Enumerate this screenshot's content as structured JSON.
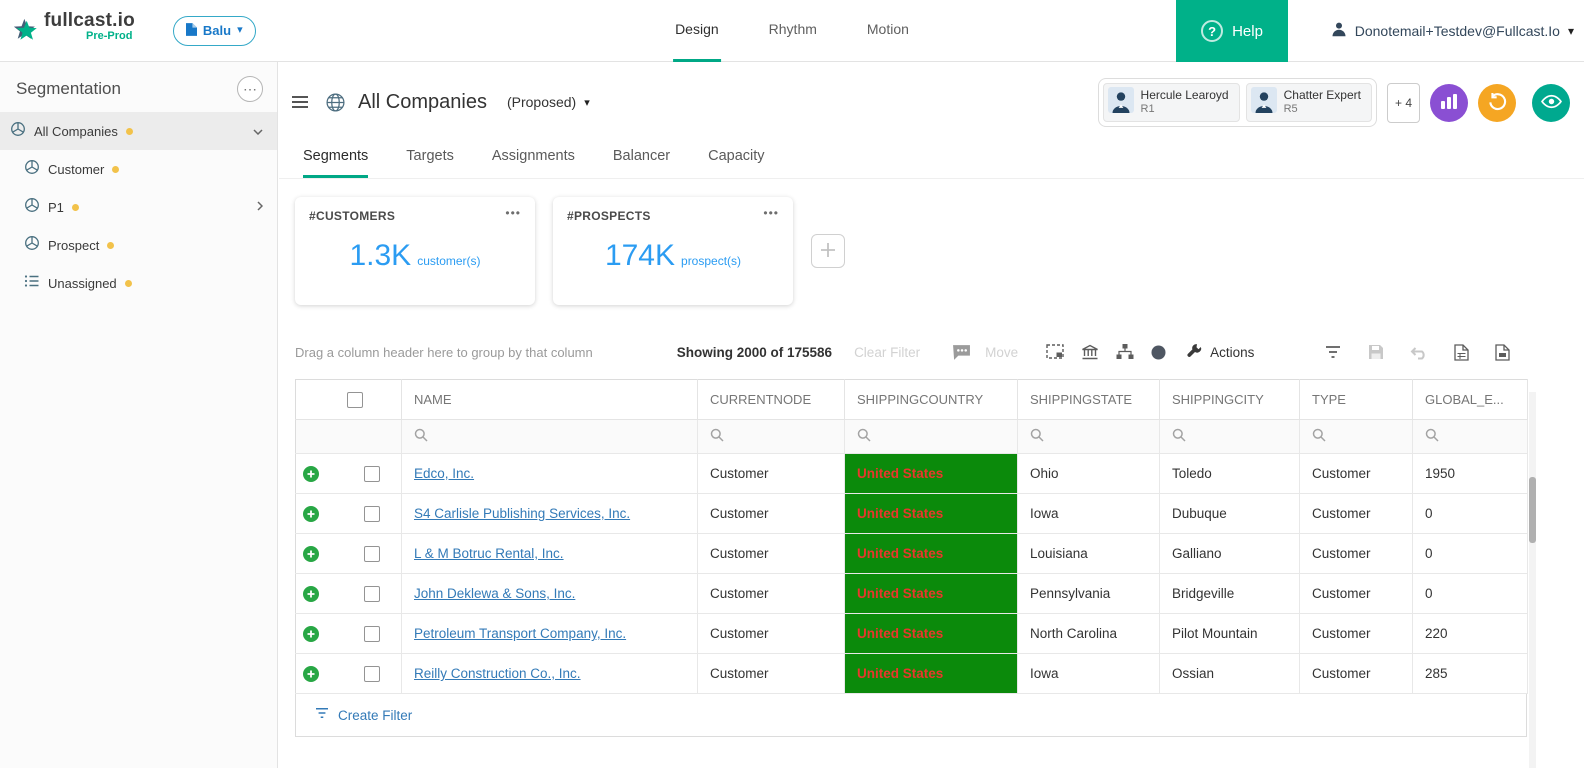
{
  "colors": {
    "brand_teal": "#00B189",
    "tab_accent": "#00A886",
    "link_blue": "#337AB7",
    "metric_blue": "#2B9CF2",
    "country_cell_bg": "#0B8A0B",
    "country_cell_text": "#E8372C",
    "node_dot_yellow": "#F2C24A",
    "purple_button": "#8A4FD3",
    "orange_button": "#F5A623",
    "teal_button": "#00A98F",
    "plus_green": "#28A745"
  },
  "icons": {
    "help_question": "?",
    "sidebar_menu": "⋯",
    "card_menu": "•••",
    "caret_down": "▾"
  },
  "header": {
    "logo_text": "fullcast.io",
    "env_label": "Pre-Prod",
    "workspace_label": "Balu",
    "nav": [
      {
        "label": "Design",
        "active": true
      },
      {
        "label": "Rhythm",
        "active": false
      },
      {
        "label": "Motion",
        "active": false
      }
    ],
    "help_label": "Help",
    "user_email": "Donotemail+Testdev@Fullcast.Io"
  },
  "sidebar": {
    "title": "Segmentation",
    "items": [
      {
        "label": "All Companies",
        "selected": true
      },
      {
        "label": "Customer",
        "selected": false
      },
      {
        "label": "P1",
        "selected": false
      },
      {
        "label": "Prospect",
        "selected": false
      },
      {
        "label": "Unassigned",
        "selected": false
      }
    ]
  },
  "view": {
    "title": "All Companies",
    "mode": "(Proposed)",
    "people": [
      {
        "name": "Hercule Learoyd",
        "role": "R1"
      },
      {
        "name": "Chatter Expert",
        "role": "R5"
      }
    ],
    "more_people": "+ 4"
  },
  "tabs": [
    {
      "label": "Segments",
      "active": true
    },
    {
      "label": "Targets",
      "active": false
    },
    {
      "label": "Assignments",
      "active": false
    },
    {
      "label": "Balancer",
      "active": false
    },
    {
      "label": "Capacity",
      "active": false
    }
  ],
  "cards": [
    {
      "label": "#CUSTOMERS",
      "value": "1.3K",
      "unit": "customer(s)"
    },
    {
      "label": "#PROSPECTS",
      "value": "174K",
      "unit": "prospect(s)"
    }
  ],
  "toolbar": {
    "drag_hint": "Drag a column header here to group by that column",
    "showing": "Showing 2000 of 175586",
    "clear_filter": "Clear Filter",
    "move": "Move",
    "actions": "Actions"
  },
  "grid": {
    "columns": [
      "NAME",
      "CURRENTNODE",
      "SHIPPINGCOUNTRY",
      "SHIPPINGSTATE",
      "SHIPPINGCITY",
      "TYPE",
      "GLOBAL_E..."
    ],
    "rows": [
      {
        "name": "Edco, Inc.",
        "currentnode": "Customer",
        "shippingcountry": "United States",
        "shippingstate": "Ohio",
        "shippingcity": "Toledo",
        "type": "Customer",
        "global_e": "1950"
      },
      {
        "name": "S4 Carlisle Publishing Services, Inc.",
        "currentnode": "Customer",
        "shippingcountry": "United States",
        "shippingstate": "Iowa",
        "shippingcity": "Dubuque",
        "type": "Customer",
        "global_e": "0"
      },
      {
        "name": "L & M Botruc Rental, Inc.",
        "currentnode": "Customer",
        "shippingcountry": "United States",
        "shippingstate": "Louisiana",
        "shippingcity": "Galliano",
        "type": "Customer",
        "global_e": "0"
      },
      {
        "name": "John Deklewa & Sons, Inc.",
        "currentnode": "Customer",
        "shippingcountry": "United States",
        "shippingstate": "Pennsylvania",
        "shippingcity": "Bridgeville",
        "type": "Customer",
        "global_e": "0"
      },
      {
        "name": "Petroleum Transport Company, Inc.",
        "currentnode": "Customer",
        "shippingcountry": "United States",
        "shippingstate": "North Carolina",
        "shippingcity": "Pilot Mountain",
        "type": "Customer",
        "global_e": "220"
      },
      {
        "name": "Reilly Construction Co., Inc.",
        "currentnode": "Customer",
        "shippingcountry": "United States",
        "shippingstate": "Iowa",
        "shippingcity": "Ossian",
        "type": "Customer",
        "global_e": "285"
      }
    ],
    "create_filter": "Create Filter"
  }
}
